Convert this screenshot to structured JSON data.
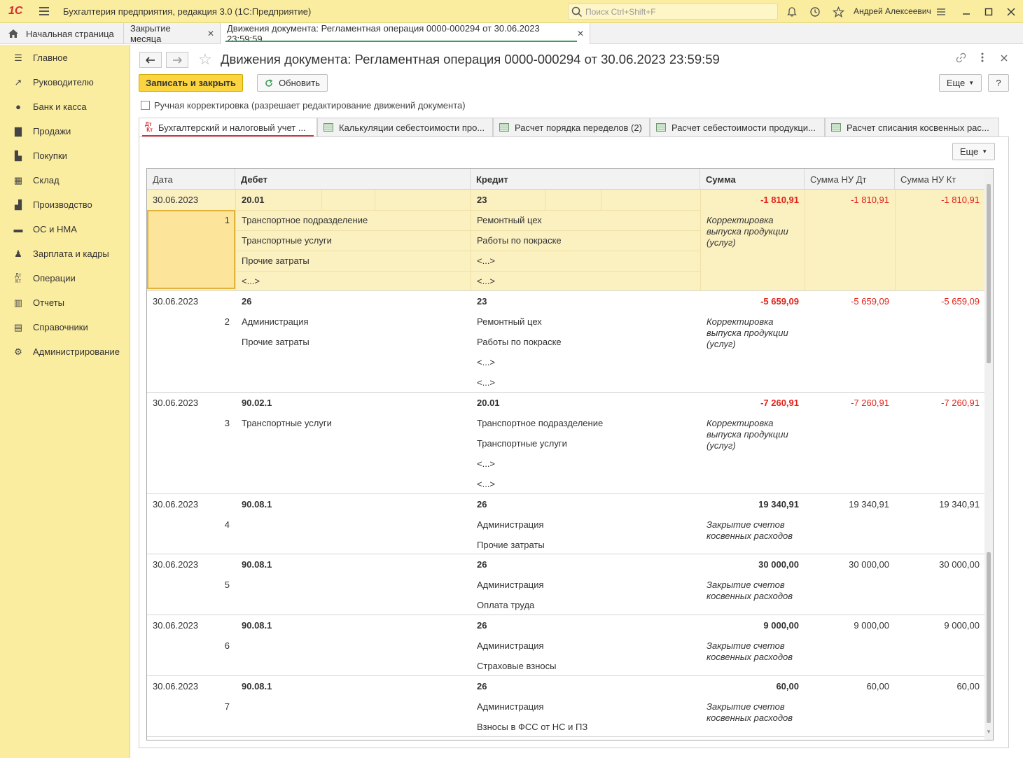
{
  "window": {
    "app_title": "Бухгалтерия предприятия, редакция 3.0  (1С:Предприятие)",
    "logo": "1С",
    "search_placeholder": "Поиск Ctrl+Shift+F",
    "user": "Андрей Алексеевич"
  },
  "tabs": [
    {
      "label": "Начальная страница"
    },
    {
      "label": "Закрытие месяца"
    },
    {
      "label": "Движения документа: Регламентная операция 0000-000294 от 30.06.2023 23:59:59"
    }
  ],
  "sidebar": {
    "items": [
      {
        "label": "Главное",
        "icon": "menu-icon"
      },
      {
        "label": "Руководителю",
        "icon": "trend-icon"
      },
      {
        "label": "Банк и касса",
        "icon": "coin-icon"
      },
      {
        "label": "Продажи",
        "icon": "bag-icon"
      },
      {
        "label": "Покупки",
        "icon": "cart-icon"
      },
      {
        "label": "Склад",
        "icon": "grid-icon"
      },
      {
        "label": "Производство",
        "icon": "factory-icon"
      },
      {
        "label": "ОС и НМА",
        "icon": "truck-icon"
      },
      {
        "label": "Зарплата и кадры",
        "icon": "person-icon"
      },
      {
        "label": "Операции",
        "icon": "dtkt-icon"
      },
      {
        "label": "Отчеты",
        "icon": "bars-icon"
      },
      {
        "label": "Справочники",
        "icon": "book-icon"
      },
      {
        "label": "Администрирование",
        "icon": "gear-icon"
      }
    ]
  },
  "document": {
    "title": "Движения документа: Регламентная операция 0000-000294 от 30.06.2023 23:59:59",
    "save_close": "Записать и закрыть",
    "refresh": "Обновить",
    "more": "Еще",
    "help": "?",
    "manual_label": "Ручная корректировка (разрешает редактирование движений документа)",
    "manual_checked": false
  },
  "form_tabs": [
    {
      "label": "Бухгалтерский и налоговый учет ..."
    },
    {
      "label": "Калькуляции себестоимости про..."
    },
    {
      "label": "Расчет порядка переделов (2)"
    },
    {
      "label": "Расчет себестоимости продукци..."
    },
    {
      "label": "Расчет списания косвенных рас..."
    }
  ],
  "grid": {
    "more": "Еще",
    "columns": [
      "Дата",
      "Дебет",
      "Кредит",
      "Сумма",
      "Сумма НУ Дт",
      "Сумма НУ Кт"
    ],
    "rows": [
      {
        "date": "30.06.2023",
        "n": "1",
        "debit": "20.01",
        "debit_sub": [
          "Транспортное подразделение",
          "Транспортные услуги",
          "Прочие затраты",
          "<...>"
        ],
        "credit": "23",
        "credit_sub": [
          "Ремонтный цех",
          "Работы по покраске",
          "<...>",
          "<...>"
        ],
        "sum": "-1 810,91",
        "content": "Корректировка выпуска продукции (услуг)",
        "nu_dt": "-1 810,91",
        "nu_kt": "-1 810,91"
      },
      {
        "date": "30.06.2023",
        "n": "2",
        "debit": "26",
        "debit_sub": [
          "Администрация",
          "Прочие затраты"
        ],
        "credit": "23",
        "credit_sub": [
          "Ремонтный цех",
          "Работы по покраске",
          "<...>",
          "<...>"
        ],
        "sum": "-5 659,09",
        "content": "Корректировка выпуска продукции (услуг)",
        "nu_dt": "-5 659,09",
        "nu_kt": "-5 659,09"
      },
      {
        "date": "30.06.2023",
        "n": "3",
        "debit": "90.02.1",
        "debit_sub": [
          "Транспортные услуги"
        ],
        "credit": "20.01",
        "credit_sub": [
          "Транспортное подразделение",
          "Транспортные услуги",
          "<...>",
          "<...>"
        ],
        "sum": "-7 260,91",
        "content": "Корректировка выпуска продукции (услуг)",
        "nu_dt": "-7 260,91",
        "nu_kt": "-7 260,91"
      },
      {
        "date": "30.06.2023",
        "n": "4",
        "debit": "90.08.1",
        "debit_sub": [],
        "credit": "26",
        "credit_sub": [
          "Администрация",
          "Прочие затраты"
        ],
        "sum": "19 340,91",
        "content": "Закрытие счетов косвенных расходов",
        "nu_dt": "19 340,91",
        "nu_kt": "19 340,91"
      },
      {
        "date": "30.06.2023",
        "n": "5",
        "debit": "90.08.1",
        "debit_sub": [],
        "credit": "26",
        "credit_sub": [
          "Администрация",
          "Оплата труда"
        ],
        "sum": "30 000,00",
        "content": "Закрытие счетов косвенных расходов",
        "nu_dt": "30 000,00",
        "nu_kt": "30 000,00"
      },
      {
        "date": "30.06.2023",
        "n": "6",
        "debit": "90.08.1",
        "debit_sub": [],
        "credit": "26",
        "credit_sub": [
          "Администрация",
          "Страховые взносы"
        ],
        "sum": "9 000,00",
        "content": "Закрытие счетов косвенных расходов",
        "nu_dt": "9 000,00",
        "nu_kt": "9 000,00"
      },
      {
        "date": "30.06.2023",
        "n": "7",
        "debit": "90.08.1",
        "debit_sub": [],
        "credit": "26",
        "credit_sub": [
          "Администрация",
          "Взносы в ФСС от НС и ПЗ"
        ],
        "sum": "60,00",
        "content": "Закрытие счетов косвенных расходов",
        "nu_dt": "60,00",
        "nu_kt": "60,00"
      }
    ]
  },
  "colors": {
    "accent": "#fbd540",
    "sidebar": "#fbeda0",
    "negative": "#e2231a",
    "selected_row": "#fbf0c0"
  }
}
